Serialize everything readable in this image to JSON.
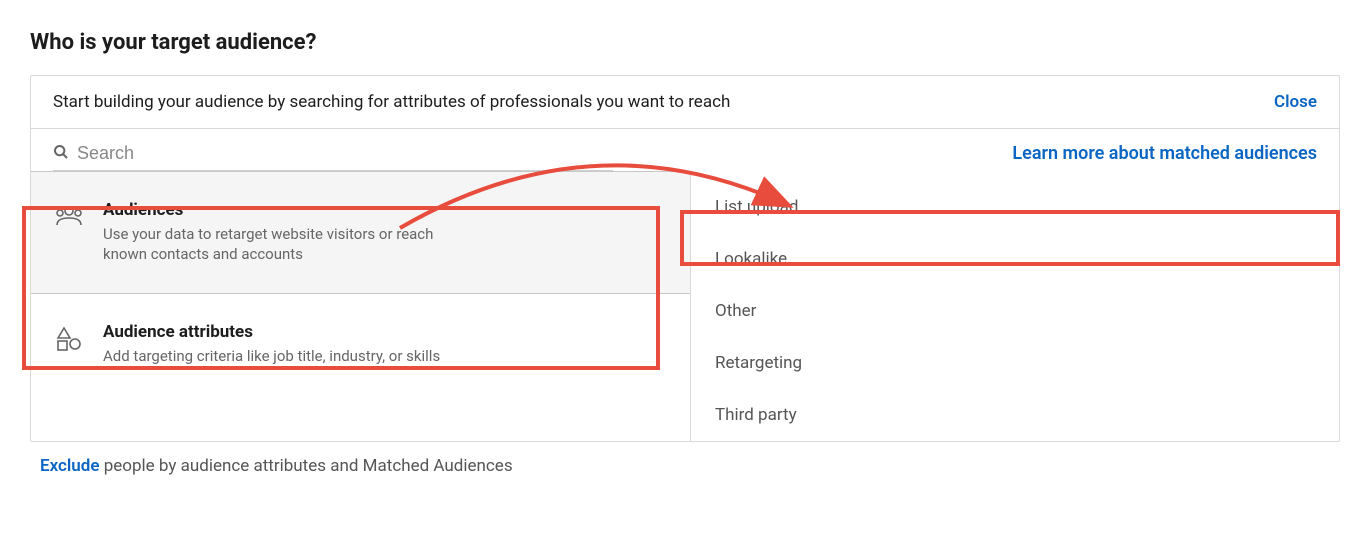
{
  "page": {
    "title": "Who is your target audience?"
  },
  "header": {
    "instruction": "Start building your audience by searching for attributes of professionals you want to reach",
    "close_label": "Close"
  },
  "search": {
    "placeholder": "Search",
    "learn_more_label": "Learn more about matched audiences"
  },
  "options": [
    {
      "title": "Audiences",
      "description": "Use your data to retarget website visitors or reach known contacts and accounts"
    },
    {
      "title": "Audience attributes",
      "description": "Add targeting criteria like job title, industry, or skills"
    }
  ],
  "sub_options": [
    "List upload",
    "Lookalike",
    "Other",
    "Retargeting",
    "Third party"
  ],
  "footer": {
    "exclude_label": "Exclude",
    "rest": " people by audience attributes and Matched Audiences"
  }
}
